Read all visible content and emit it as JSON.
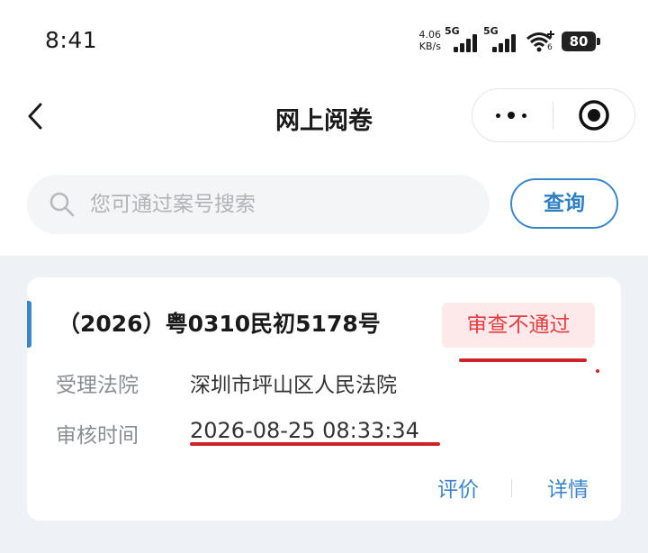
{
  "status_bar": {
    "time": "8:41",
    "net_speed_value": "4.06",
    "net_speed_unit": "KB/s",
    "signal1_label": "5G",
    "signal2_label": "5G",
    "wifi_sub": "6",
    "battery": "80"
  },
  "nav": {
    "title": "网上阅卷"
  },
  "search": {
    "placeholder": "您可通过案号搜索",
    "value": "",
    "button_label": "查询"
  },
  "cases": [
    {
      "case_no": "（2026）粤0310民初5178号",
      "status": "审查不通过",
      "court_label": "受理法院",
      "court_value": "深圳市坪山区人民法院",
      "time_label": "审核时间",
      "time_value": "2026-08-25 08:33:34",
      "action_review": "评价",
      "action_detail": "详情"
    }
  ],
  "colors": {
    "accent": "#3b86c9",
    "status_text": "#e23d3f",
    "status_bg": "#fde9ea",
    "annotation": "#d0202a"
  }
}
